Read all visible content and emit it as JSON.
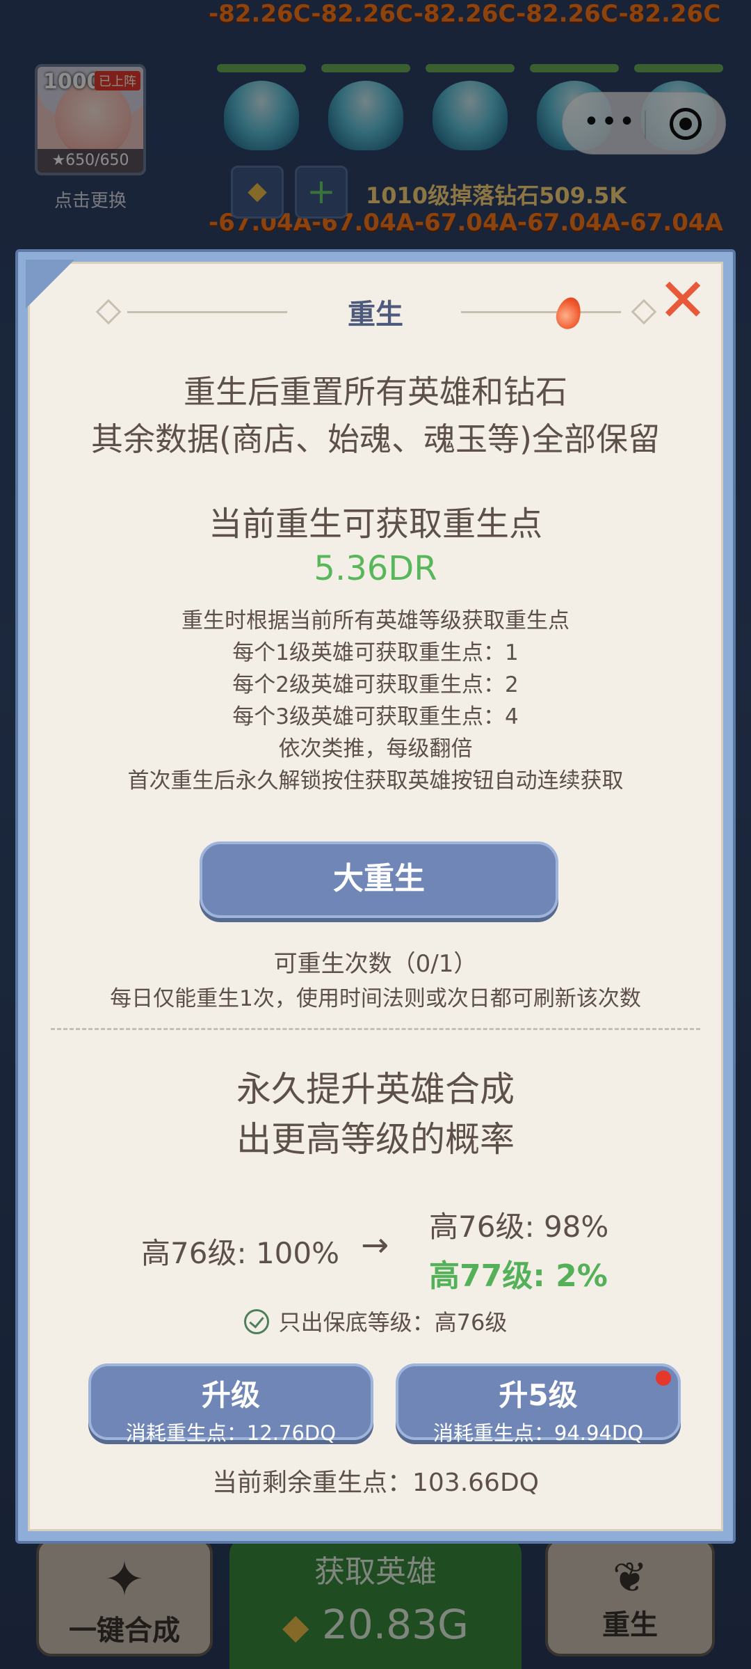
{
  "background": {
    "floating_top": "-82.26C-82.26C-82.26C-82.26C-82.26C",
    "floating_mid": "-67.04A-67.04A-67.04A-67.04A-67.04A",
    "avatar": {
      "level": "1000",
      "tag": "已上阵",
      "count": "★650/650",
      "caption": "点击更换"
    },
    "drop_text": "1010级掉落钻石509.5K",
    "mini_plus": "+",
    "bottom": {
      "left_label": "一键合成",
      "center_title": "获取英雄",
      "center_value": "20.83G",
      "right_label": "重生"
    }
  },
  "capsule": {
    "more": "•••"
  },
  "modal": {
    "title": "重生",
    "close": "✕",
    "intro_line1": "重生后重置所有英雄和钻石",
    "intro_line2": "其余数据(商店、始魂、魂玉等)全部保留",
    "gain_heading": "当前重生可获取重生点",
    "gain_value": "5.36DR",
    "rules": [
      "重生时根据当前所有英雄等级获取重生点",
      "每个1级英雄可获取重生点：1",
      "每个2级英雄可获取重生点：2",
      "每个3级英雄可获取重生点：4",
      "依次类推，每级翻倍",
      "首次重生后永久解锁按住获取英雄按钮自动连续获取"
    ],
    "big_button": "大重生",
    "remaining_count": "可重生次数（0/1）",
    "daily_hint": "每日仅能重生1次，使用时间法则或次日都可刷新该次数",
    "perm_line1": "永久提升英雄合成",
    "perm_line2": "出更高等级的概率",
    "prob_current": "高76级: 100%",
    "arrow": "→",
    "prob_next_1": "高76级: 98%",
    "prob_next_2": "高77级: 2%",
    "guarantee_text": "只出保底等级：高76级",
    "upgrade": {
      "label": "升级",
      "cost": "消耗重生点：12.76DQ"
    },
    "upgrade5": {
      "label": "升5级",
      "cost": "消耗重生点：94.94DQ"
    },
    "remain_points": "当前剩余重生点：103.66DQ"
  }
}
